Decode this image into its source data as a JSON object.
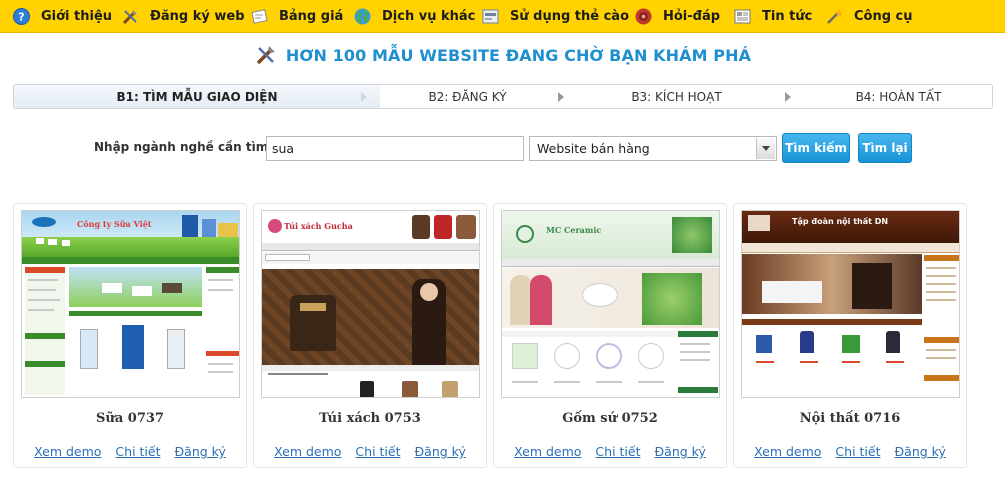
{
  "nav": {
    "items": [
      {
        "label": "Giới thiệu",
        "icon": "help-icon"
      },
      {
        "label": "Đăng ký web",
        "icon": "tools-icon"
      },
      {
        "label": "Bảng giá",
        "icon": "price-list-icon"
      },
      {
        "label": "Dịch vụ khác",
        "icon": "globe-icon"
      },
      {
        "label": "Sử dụng thẻ cào",
        "icon": "scratch-card-icon"
      },
      {
        "label": "Hỏi-đáp",
        "icon": "qa-icon"
      },
      {
        "label": "Tin tức",
        "icon": "news-icon"
      },
      {
        "label": "Công cụ",
        "icon": "magic-wand-icon"
      }
    ]
  },
  "headline": "HƠN 100 MẪU WEBSITE ĐANG CHỜ BẠN KHÁM PHÁ",
  "steps": [
    {
      "label": "B1: TÌM MẪU GIAO DIỆN",
      "active": true
    },
    {
      "label": "B2: ĐĂNG KÝ",
      "active": false
    },
    {
      "label": "B3: KÍCH HOẠT",
      "active": false
    },
    {
      "label": "B4: HOÀN TẤT",
      "active": false
    }
  ],
  "search": {
    "label": "Nhập ngành nghề cần tìm:",
    "value": "sua",
    "category": "Website bán hàng",
    "search_button": "Tìm kiếm",
    "reset_button": "Tìm lại"
  },
  "templates": [
    {
      "name": "Sữa 0737",
      "theme": "milk",
      "site_title": "Công ty Sữa Việt"
    },
    {
      "name": "Túi xách 0753",
      "theme": "bags",
      "site_title": "Túi xách Gucha"
    },
    {
      "name": "Gốm sứ 0752",
      "theme": "ceramic",
      "site_title": "MC Ceramic"
    },
    {
      "name": "Nội thất 0716",
      "theme": "furniture",
      "site_title": "Tập đoàn nội thất DN"
    }
  ],
  "card_links": {
    "demo": "Xem demo",
    "detail": "Chi tiết",
    "register": "Đăng ký"
  },
  "colors": {
    "nav_bg": "#ffd200",
    "accent": "#1f8fd0",
    "button": "#1793d6",
    "link": "#2b6fb5"
  }
}
